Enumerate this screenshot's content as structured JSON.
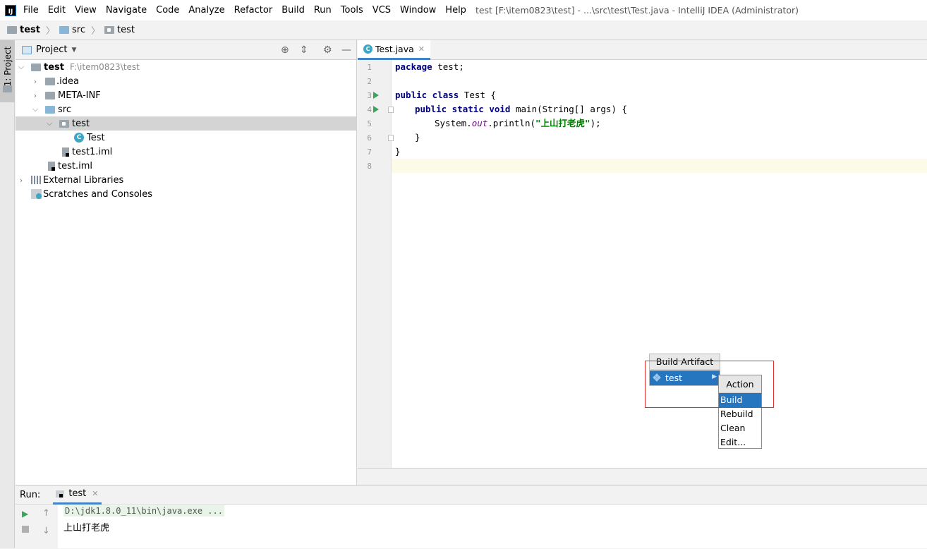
{
  "menubar": {
    "items": [
      "File",
      "Edit",
      "View",
      "Navigate",
      "Code",
      "Analyze",
      "Refactor",
      "Build",
      "Run",
      "Tools",
      "VCS",
      "Window",
      "Help"
    ],
    "title": "test [F:\\item0823\\test] - ...\\src\\test\\Test.java - IntelliJ IDEA (Administrator)"
  },
  "breadcrumb": [
    "test",
    "src",
    "test"
  ],
  "left_strip": {
    "project_tab": "1: Project"
  },
  "project_panel": {
    "title": "Project",
    "tree": [
      {
        "label": "test",
        "path": "F:\\item0823\\test"
      },
      {
        "label": ".idea"
      },
      {
        "label": "META-INF"
      },
      {
        "label": "src"
      },
      {
        "label": "test"
      },
      {
        "label": "Test"
      },
      {
        "label": "test1.iml"
      },
      {
        "label": "test.iml"
      },
      {
        "label": "External Libraries"
      },
      {
        "label": "Scratches and Consoles"
      }
    ]
  },
  "editor": {
    "tab_label": "Test.java",
    "line_numbers": [
      "1",
      "2",
      "3",
      "4",
      "5",
      "6",
      "7",
      "8"
    ],
    "code": {
      "l1_kw": "package",
      "l1_rest": " test;",
      "l3_kw": "public class",
      "l3_rest": " Test {",
      "l4_kw": "public static void",
      "l4_rest": " main(String[] args) {",
      "l5_a": "System.",
      "l5_field": "out",
      "l5_b": ".println(",
      "l5_str": "\"上山打老虎\"",
      "l5_c": ");",
      "l6": "}",
      "l7": "}"
    }
  },
  "run_panel": {
    "label": "Run:",
    "tab": "test",
    "command": "D:\\jdk1.8.0_11\\bin\\java.exe ...",
    "output": "上山打老虎"
  },
  "build_artifact_popup": {
    "title": "Build Artifact",
    "item": "test"
  },
  "action_popup": {
    "title": "Action",
    "items": [
      "Build",
      "Rebuild",
      "Clean",
      "Edit..."
    ]
  },
  "colors": {
    "selection": "#2675bf",
    "highlight_box": "#e03030",
    "keyword": "#000080",
    "string": "#008000",
    "run_green": "#3ca35b"
  }
}
